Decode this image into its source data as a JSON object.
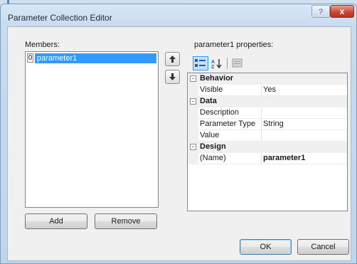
{
  "window": {
    "title": "Parameter Collection Editor",
    "help_label": "?",
    "close_label": "x",
    "accent": "#3399ff"
  },
  "members": {
    "label": "Members:",
    "items": [
      {
        "index": "0",
        "label": "parameter1",
        "selected": true
      }
    ],
    "add_label": "Add",
    "remove_label": "Remove"
  },
  "properties": {
    "header": "parameter1 properties:",
    "toolbar": [
      {
        "icon": "categorized-icon",
        "active": true
      },
      {
        "icon": "alphabetical-sort-icon",
        "active": false
      },
      {
        "icon": "property-pages-icon",
        "active": false
      }
    ],
    "categories": [
      {
        "name": "Behavior",
        "toggle": "-",
        "rows": [
          {
            "name": "Visible",
            "value": "Yes",
            "bold": false
          }
        ]
      },
      {
        "name": "Data",
        "toggle": "-",
        "rows": [
          {
            "name": "Description",
            "value": "",
            "bold": false
          },
          {
            "name": "Parameter Type",
            "value": "String",
            "bold": false
          },
          {
            "name": "Value",
            "value": "",
            "bold": false
          }
        ]
      },
      {
        "name": "Design",
        "toggle": "-",
        "rows": [
          {
            "name": "(Name)",
            "value": "parameter1",
            "bold": true
          }
        ]
      }
    ]
  },
  "footer": {
    "ok_label": "OK",
    "cancel_label": "Cancel"
  }
}
